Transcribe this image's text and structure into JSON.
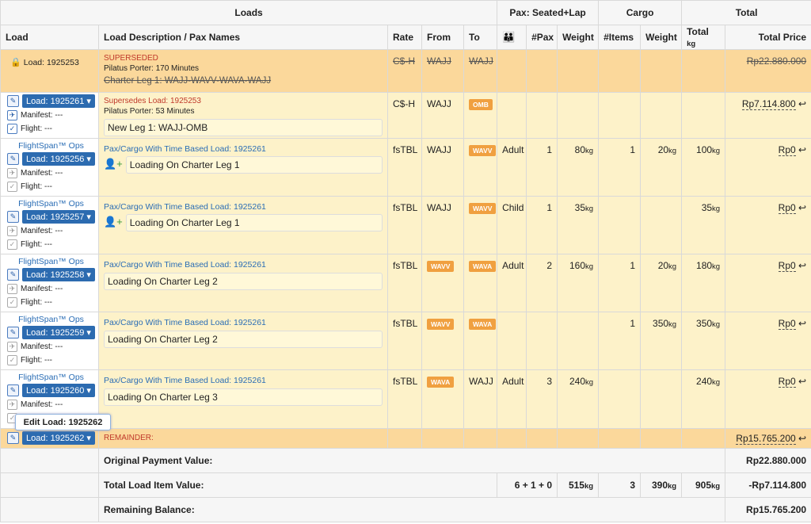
{
  "header": {
    "loads": "Loads",
    "pax": "Pax: Seated+Lap",
    "cargo": "Cargo",
    "total": "Total",
    "load": "Load",
    "desc": "Load Description / Pax Names",
    "rate": "Rate",
    "from": "From",
    "to": "To",
    "npax": "#Pax",
    "weight": "Weight",
    "nitems": "#Items",
    "cweight": "Weight",
    "total_kg": "Total",
    "kg": "kg",
    "total_price": "Total Price"
  },
  "superseded": {
    "load": "Load: 1925253",
    "status": "SUPERSEDED",
    "aircraft": "Pilatus Porter: 170 Minutes",
    "leg": "Charter Leg 1: WAJJ-WAVV-WAVA-WAJJ",
    "rate": "C$-H",
    "from": "WAJJ",
    "to": "WAJJ",
    "price": "Rp22.880.000"
  },
  "main": {
    "load": "Load: 1925261",
    "note": "Supersedes Load: 1925253",
    "aircraft": "Pilatus Porter: 53 Minutes",
    "leg": "New Leg 1: WAJJ-OMB",
    "rate": "C$-H",
    "from": "WAJJ",
    "to": "OMB",
    "price": "Rp7.114.800",
    "manifest": "Manifest: ---",
    "flight": "Flight: ---"
  },
  "ops_label": "FlightSpan™ Ops",
  "manifest": "Manifest: ---",
  "flight": "Flight: ---",
  "rows": [
    {
      "load": "Load: 1925256",
      "desc": "Pax/Cargo With Time Based Load: 1925261",
      "leg": "Loading On Charter Leg 1",
      "rate": "fsTBL",
      "from": "WAJJ",
      "to": "WAVV",
      "type": "Adult",
      "pax": "1",
      "weight": "80",
      "items": "1",
      "cweight": "20",
      "total": "100",
      "price": "Rp0"
    },
    {
      "load": "Load: 1925257",
      "desc": "Pax/Cargo With Time Based Load: 1925261",
      "leg": "Loading On Charter Leg 1",
      "rate": "fsTBL",
      "from": "WAJJ",
      "to": "WAVV",
      "type": "Child",
      "pax": "1",
      "weight": "35",
      "items": "",
      "cweight": "",
      "total": "35",
      "price": "Rp0"
    },
    {
      "load": "Load: 1925258",
      "desc": "Pax/Cargo With Time Based Load: 1925261",
      "leg": "Loading On Charter Leg 2",
      "rate": "fsTBL",
      "from": "WAVV",
      "to": "WAVA",
      "type": "Adult",
      "pax": "2",
      "weight": "160",
      "items": "1",
      "cweight": "20",
      "total": "180",
      "price": "Rp0"
    },
    {
      "load": "Load: 1925259",
      "desc": "Pax/Cargo With Time Based Load: 1925261",
      "leg": "Loading On Charter Leg 2",
      "rate": "fsTBL",
      "from": "WAVV",
      "to": "WAVA",
      "type": "",
      "pax": "",
      "weight": "",
      "items": "1",
      "cweight": "350",
      "total": "350",
      "price": "Rp0"
    },
    {
      "load": "Load: 1925260",
      "desc": "Pax/Cargo With Time Based Load: 1925261",
      "leg": "Loading On Charter Leg 3",
      "rate": "fsTBL",
      "from": "WAVA",
      "to": "WAJJ",
      "type": "Adult",
      "pax": "3",
      "weight": "240",
      "items": "",
      "cweight": "",
      "total": "240",
      "price": "Rp0"
    }
  ],
  "tooltip": "Edit Load: 1925262",
  "remainder": {
    "load": "Load: 1925262",
    "label": "REMAINDER:",
    "price": "Rp15.765.200"
  },
  "summary": {
    "orig_label": "Original Payment Value:",
    "orig_value": "Rp22.880.000",
    "tli_label": "Total Load Item Value:",
    "tli_pax": "6 + 1 + 0",
    "tli_weight": "515",
    "tli_items": "3",
    "tli_cweight": "390",
    "tli_total": "905",
    "tli_value": "-Rp7.114.800",
    "rem_label": "Remaining Balance:",
    "rem_value": "Rp15.765.200"
  }
}
